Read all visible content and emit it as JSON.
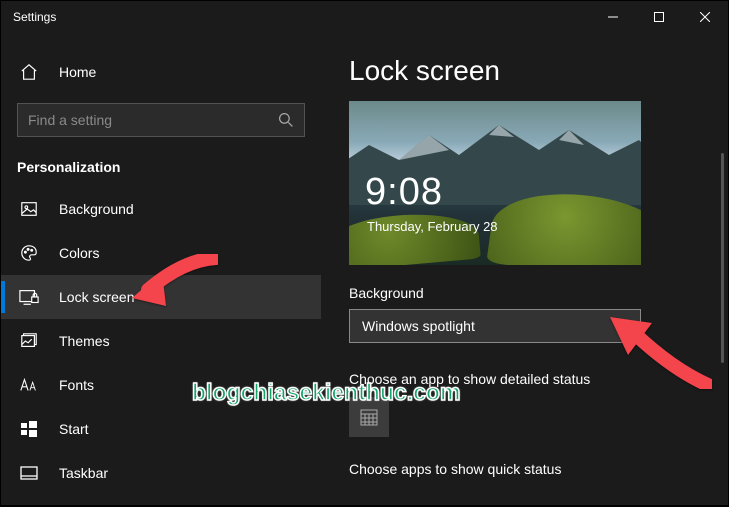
{
  "window": {
    "title": "Settings"
  },
  "sidebar": {
    "home": "Home",
    "search_placeholder": "Find a setting",
    "category": "Personalization",
    "items": [
      {
        "label": "Background",
        "icon": "picture-icon"
      },
      {
        "label": "Colors",
        "icon": "palette-icon"
      },
      {
        "label": "Lock screen",
        "icon": "lockscreen-icon",
        "selected": true
      },
      {
        "label": "Themes",
        "icon": "themes-icon"
      },
      {
        "label": "Fonts",
        "icon": "fonts-icon"
      },
      {
        "label": "Start",
        "icon": "start-icon"
      },
      {
        "label": "Taskbar",
        "icon": "taskbar-icon"
      }
    ]
  },
  "content": {
    "title": "Lock screen",
    "preview": {
      "time": "9:08",
      "date": "Thursday, February 28"
    },
    "background_label": "Background",
    "background_value": "Windows spotlight",
    "detailed_status_label": "Choose an app to show detailed status",
    "quick_status_label": "Choose apps to show quick status"
  },
  "watermark": "blogchiasekienthuc.com"
}
